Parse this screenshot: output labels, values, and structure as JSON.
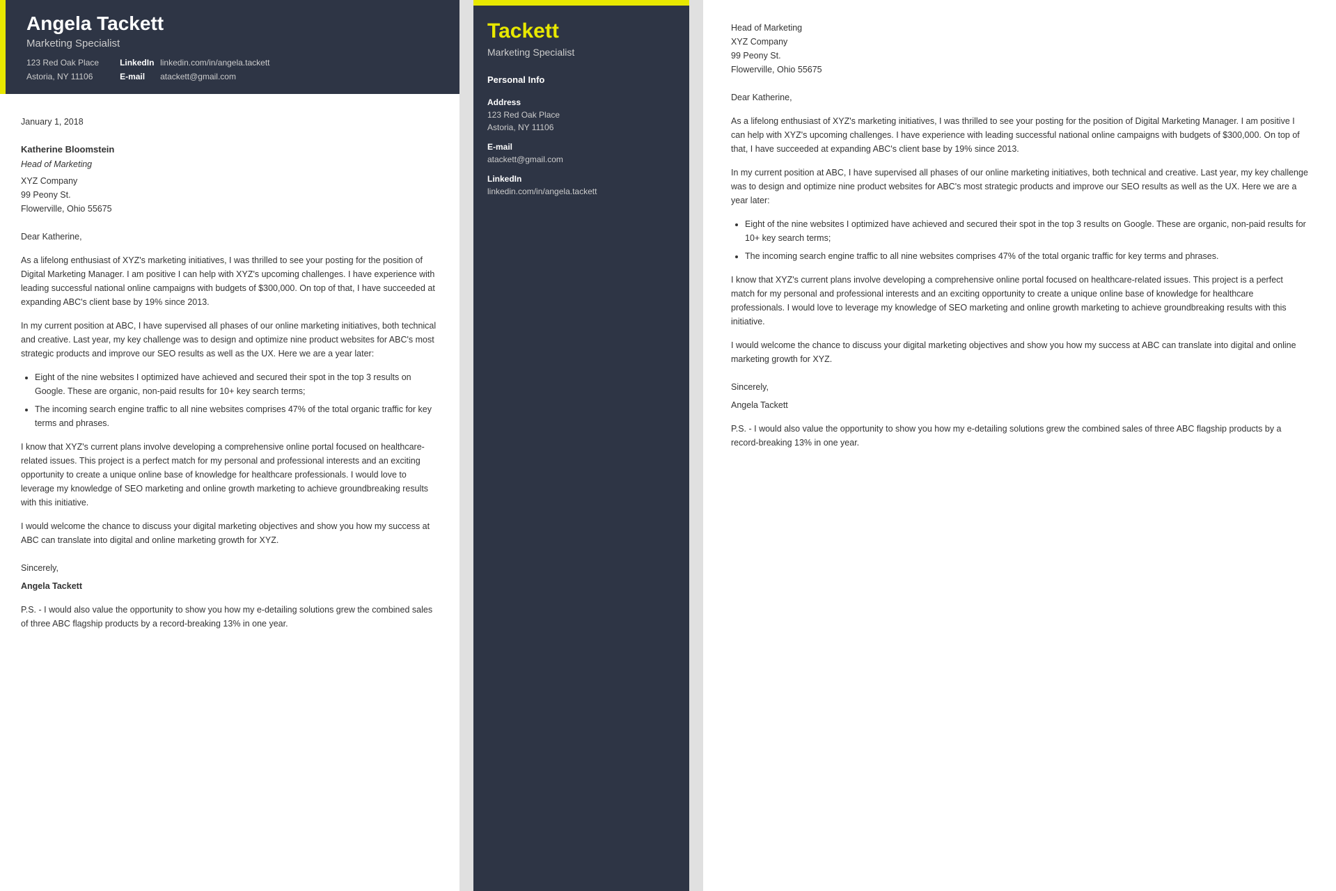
{
  "left": {
    "header": {
      "name": "Angela Tackett",
      "title": "Marketing Specialist",
      "address": "123 Red Oak Place",
      "city_state": "Astoria, NY 11106",
      "linkedin_label": "LinkedIn",
      "linkedin_value": "linkedin.com/in/angela.tackett",
      "email_label": "E-mail",
      "email_value": "atackett@gmail.com"
    },
    "body": {
      "date": "January 1, 2018",
      "recipient_name": "Katherine Bloomstein",
      "recipient_title": "Head of Marketing",
      "recipient_company": "XYZ Company",
      "recipient_address1": "99 Peony St.",
      "recipient_city": "Flowerville, Ohio 55675",
      "salutation": "Dear Katherine,",
      "para1": "As a lifelong enthusiast of XYZ's marketing initiatives, I was thrilled to see your posting for the position of Digital Marketing Manager. I am positive I can help with XYZ's upcoming challenges. I have experience with leading successful national online campaigns with budgets of $300,000. On top of that, I have succeeded at expanding ABC's client base by 19% since 2013.",
      "para2": "In my current position at ABC, I have supervised all phases of our online marketing initiatives, both technical and creative. Last year, my key challenge was to design and optimize nine product websites for ABC's most strategic products and improve our SEO results as well as the UX. Here we are a year later:",
      "bullet1": "Eight of the nine websites I optimized have achieved and secured their spot in the top 3 results on Google. These are organic, non-paid results for 10+ key search terms;",
      "bullet2": "The incoming search engine traffic to all nine websites comprises 47% of the total organic traffic for key terms and phrases.",
      "para3": "I know that XYZ's current plans involve developing a comprehensive online portal focused on healthcare-related issues. This project is a perfect match for my personal and professional interests and an exciting opportunity to create a unique online base of knowledge for healthcare professionals. I would love to leverage my knowledge of SEO marketing and online growth marketing to achieve groundbreaking results with this initiative.",
      "para4": "I would welcome the chance to discuss your digital marketing objectives and show you how my success at ABC can translate into digital and online marketing growth for XYZ.",
      "closing": "Sincerely,",
      "signature": "Angela Tackett",
      "ps": "P.S. - I would also value the opportunity to show you how my e-detailing solutions grew the combined sales of three ABC flagship products by a record-breaking 13% in one year."
    }
  },
  "middle": {
    "header": {
      "name_line1": "Tackett",
      "title": "Marketing Specialist"
    },
    "personal_info_section": "Personal Info",
    "personal_info": {
      "address_label": "Address",
      "address_line1": "123 Red Oak Place",
      "address_line2": "Astoria, NY 11106",
      "email_label": "E-mail",
      "email_value": "atackett@gmail.com",
      "linkedin_label": "LinkedIn",
      "linkedin_value": "linkedin.com/in/angela.tackett"
    }
  },
  "right": {
    "recipient": {
      "name": "Head of Marketing",
      "company": "XYZ Company",
      "address1": "99 Peony St.",
      "city": "Flowerville, Ohio 55675"
    },
    "salutation": "Dear Katherine,",
    "para1": "As a lifelong enthusiast of XYZ's marketing initiatives, I was thrilled to see your pos... position of Digital Marketing Manager. I am positive I can help with XYZ's upcoming... have experience with leading successful national online campaigns with budgets o... On top of that, I have succeeded at expanding ABC's client base by 19% since 20...",
    "para1_full": "As a lifelong enthusiast of XYZ's marketing initiatives, I was thrilled to see your posting for the position of Digital Marketing Manager. I am positive I can help with XYZ's upcoming challenges. I have experience with leading successful national online campaigns with budgets of $300,000. On top of that, I have succeeded at expanding ABC's client base by 19% since 2013.",
    "para2_full": "In my current position at ABC, I have supervised all phases of our online marketing initiatives, both technical and creative. Last year, my key challenge was to design and optimize nine product websites for ABC's most strategic products and improve our SEO results as well as the UX. Here we are a year later:",
    "bullet1": "Eight of the nine websites I optimized have achieved and secured their spot in the top 3 results on Google. These are organic, non-paid results for 10+ key search terms;",
    "bullet2": "The incoming search engine traffic to all nine websites comprises 47% of the total organic traffic for key terms and phrases.",
    "para3_full": "I know that XYZ's current plans involve developing a comprehensive online portal focused on healthcare-related issues. This project is a perfect match for my personal and professional interests and an exciting opportunity to create a unique online base of knowledge for healthcare professionals. I would love to leverage my knowledge of SEO marketing and online growth marketing to achieve groundbreaking results with this initiative.",
    "para4_full": "I would welcome the chance to discuss your digital marketing objectives and show you how my success at ABC can translate into digital and online marketing growth for XYZ.",
    "closing": "Sincerely,",
    "signature": "Angela Tackett",
    "ps": "P.S. - I would also value the opportunity to show you how my e-detailing solutions grew the combined sales of three ABC flagship products by a record-breaking 13% in one year."
  }
}
